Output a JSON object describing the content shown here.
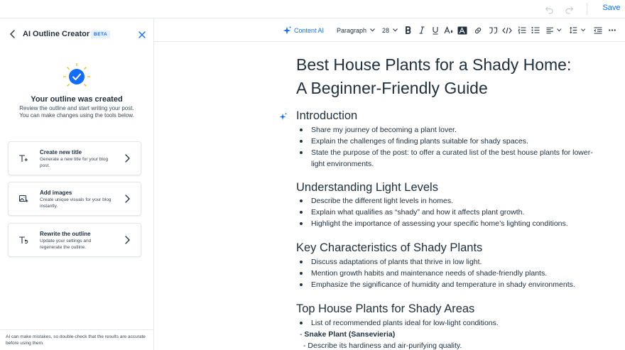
{
  "topbar": {
    "save_label": "Save",
    "undo_icon": "undo-icon",
    "redo_icon": "redo-icon"
  },
  "panel": {
    "title": "AI Outline Creator",
    "badge": "BETA",
    "success_heading": "Your outline was created",
    "success_desc_1": "Review the outline and start writing your post.",
    "success_desc_2": "You can make changes using the tools below.",
    "cards": [
      {
        "title": "Create new title",
        "desc": "Generate a new title for your blog post.",
        "icon": "text-title-icon"
      },
      {
        "title": "Add images",
        "desc": "Create unique visuals for your blog instantly.",
        "icon": "image-add-icon"
      },
      {
        "title": "Rewrite the outline",
        "desc": "Update your settings and regenerate the outline.",
        "icon": "text-rewrite-icon"
      }
    ],
    "disclaimer": "AI can make mistakes, so double-check that the results are accurate before using them."
  },
  "toolbar": {
    "content_ai": "Content AI",
    "paragraph": "Paragraph",
    "font_size": "28"
  },
  "doc": {
    "title_line_1": "Best House Plants for a Shady Home:",
    "title_line_2": "A Beginner-Friendly Guide",
    "sections": [
      {
        "heading": "Introduction",
        "bullets": [
          "Share my journey of becoming a plant lover.",
          "Explain the challenges of finding plants suitable for shady spaces.",
          "State the purpose of the post: to offer a curated list of the best house plants for lower-light environments."
        ]
      },
      {
        "heading": "Understanding Light Levels",
        "bullets": [
          "Describe the different light levels in homes.",
          "Explain what qualifies as “shady” and how it affects plant growth.",
          "Highlight the importance of assessing your specific home’s lighting conditions."
        ]
      },
      {
        "heading": "Key Characteristics of Shady Plants",
        "bullets": [
          "Discuss adaptations of plants that thrive in low light.",
          "Mention growth habits and maintenance needs of shade-friendly plants.",
          "Emphasize the significance of humidity and temperature in shady environments."
        ]
      },
      {
        "heading": "Top House Plants for Shady Areas",
        "bullets": [
          "List of recommended plants ideal for low-light conditions."
        ],
        "extra_prefix": "- ",
        "extra_bold": "Snake Plant (Sansevieria)",
        "extra_line": "- Describe its hardiness and air-purifying quality."
      }
    ]
  },
  "colors": {
    "accent": "#116dff",
    "text": "#20303c"
  }
}
